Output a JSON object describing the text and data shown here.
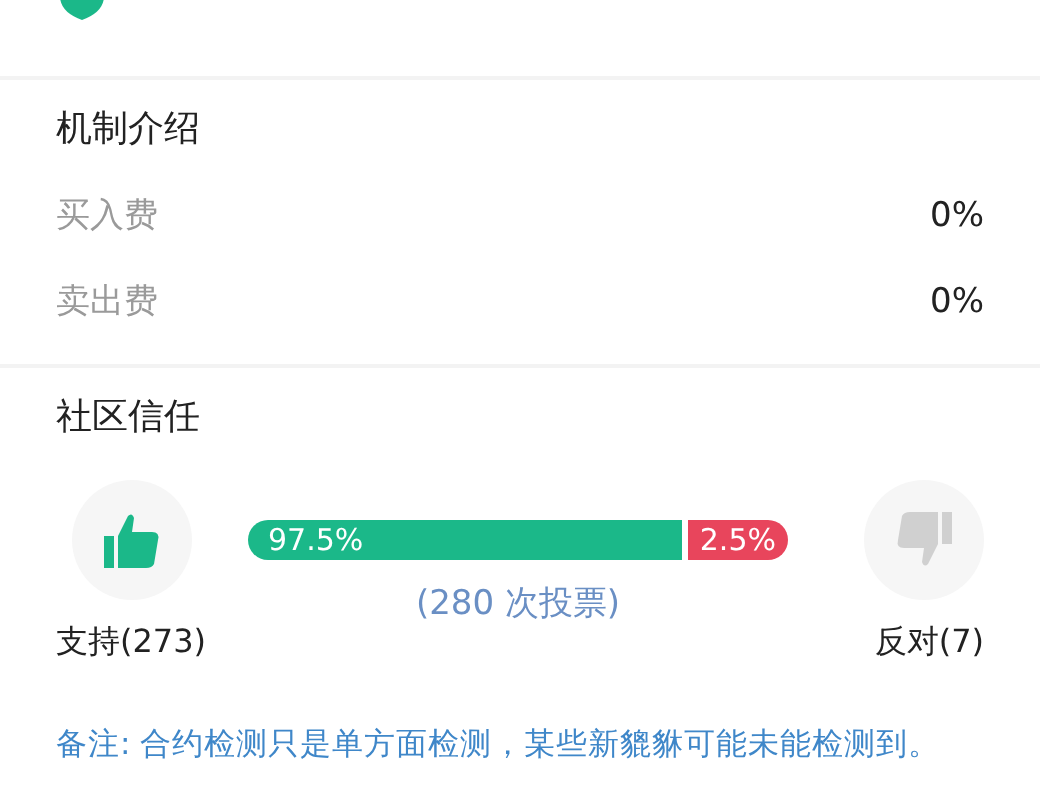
{
  "mechanism": {
    "title": "机制介绍",
    "rows": [
      {
        "label": "买入费",
        "value": "0%"
      },
      {
        "label": "卖出费",
        "value": "0%"
      }
    ]
  },
  "trust": {
    "title": "社区信任",
    "bar": {
      "support_label": "97.5%",
      "oppose_label": "2.5%"
    },
    "votes": "(280 次投票)",
    "support": "支持(273)",
    "oppose": "反对(7)"
  },
  "note": "备注: 合约检测只是单方面检测，某些新貔貅可能未能检测到。"
}
